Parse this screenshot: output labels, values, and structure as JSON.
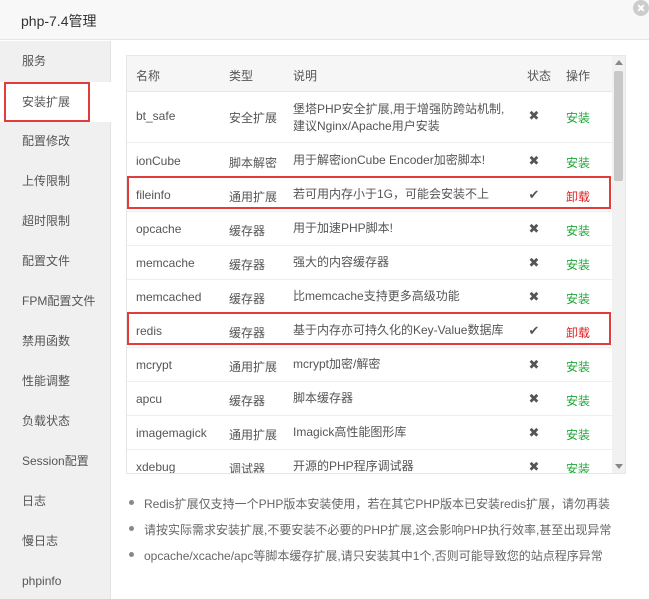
{
  "window": {
    "title": "php-7.4管理"
  },
  "sidebar": {
    "items": [
      {
        "label": "服务"
      },
      {
        "label": "安装扩展"
      },
      {
        "label": "配置修改"
      },
      {
        "label": "上传限制"
      },
      {
        "label": "超时限制"
      },
      {
        "label": "配置文件"
      },
      {
        "label": "FPM配置文件"
      },
      {
        "label": "禁用函数"
      },
      {
        "label": "性能调整"
      },
      {
        "label": "负载状态"
      },
      {
        "label": "Session配置"
      },
      {
        "label": "日志"
      },
      {
        "label": "慢日志"
      },
      {
        "label": "phpinfo"
      }
    ]
  },
  "table": {
    "headers": {
      "name": "名称",
      "type": "类型",
      "desc": "说明",
      "status": "状态",
      "action": "操作"
    },
    "rows": [
      {
        "name": "bt_safe",
        "type": "安全扩展",
        "desc": "堡塔PHP安全扩展,用于增强防跨站机制,建议Nginx/Apache用户安装",
        "status": "✖",
        "action": "安装"
      },
      {
        "name": "ionCube",
        "type": "脚本解密",
        "desc": "用于解密ionCube Encoder加密脚本!",
        "status": "✖",
        "action": "安装"
      },
      {
        "name": "fileinfo",
        "type": "通用扩展",
        "desc": "若可用内存小于1G，可能会安装不上",
        "status": "✔",
        "action": "卸载"
      },
      {
        "name": "opcache",
        "type": "缓存器",
        "desc": "用于加速PHP脚本!",
        "status": "✖",
        "action": "安装"
      },
      {
        "name": "memcache",
        "type": "缓存器",
        "desc": "强大的内容缓存器",
        "status": "✖",
        "action": "安装"
      },
      {
        "name": "memcached",
        "type": "缓存器",
        "desc": "比memcache支持更多高级功能",
        "status": "✖",
        "action": "安装"
      },
      {
        "name": "redis",
        "type": "缓存器",
        "desc": "基于内存亦可持久化的Key-Value数据库",
        "status": "✔",
        "action": "卸载"
      },
      {
        "name": "mcrypt",
        "type": "通用扩展",
        "desc": "mcrypt加密/解密",
        "status": "✖",
        "action": "安装"
      },
      {
        "name": "apcu",
        "type": "缓存器",
        "desc": "脚本缓存器",
        "status": "✖",
        "action": "安装"
      },
      {
        "name": "imagemagick",
        "type": "通用扩展",
        "desc": "Imagick高性能图形库",
        "status": "✖",
        "action": "安装"
      },
      {
        "name": "xdebug",
        "type": "调试器",
        "desc": "开源的PHP程序调试器",
        "status": "✖",
        "action": "安装"
      }
    ]
  },
  "notes": [
    "Redis扩展仅支持一个PHP版本安装使用，若在其它PHP版本已安装redis扩展，请勿再装",
    "请按实际需求安装扩展,不要安装不必要的PHP扩展,这会影响PHP执行效率,甚至出现异常",
    "opcache/xcache/apc等脚本缓存扩展,请只安装其中1个,否则可能导致您的站点程序异常"
  ],
  "colors": {
    "install": "#20a53a",
    "uninstall": "#e02020",
    "highlight": "#e03c3c"
  }
}
